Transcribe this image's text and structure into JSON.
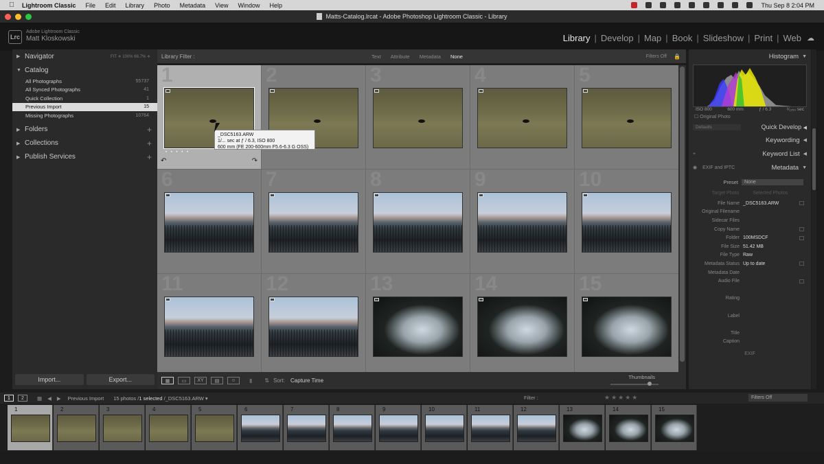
{
  "menubar": {
    "app": "Lightroom Classic",
    "items": [
      "File",
      "Edit",
      "Library",
      "Photo",
      "Metadata",
      "View",
      "Window",
      "Help"
    ],
    "clock": "Thu Sep 8  2:04 PM"
  },
  "window": {
    "title": "Matts-Catalog.lrcat - Adobe Photoshop Lightroom Classic - Library"
  },
  "identity": {
    "product": "Adobe Lightroom Classic",
    "user": "Matt Kloskowski",
    "logo": "Lrc"
  },
  "modules": [
    "Library",
    "Develop",
    "Map",
    "Book",
    "Slideshow",
    "Print",
    "Web"
  ],
  "left": {
    "navigator": {
      "label": "Navigator",
      "zoom": "FIT ≑  100%  66.7% ≑"
    },
    "catalog": {
      "label": "Catalog",
      "items": [
        {
          "name": "All Photographs",
          "count": "55737"
        },
        {
          "name": "All Synced Photographs",
          "count": "41"
        },
        {
          "name": "Quick Collection",
          "count": "1"
        },
        {
          "name": "Previous Import",
          "count": "15"
        },
        {
          "name": "Missing Photographs",
          "count": "10764"
        }
      ]
    },
    "folders": "Folders",
    "collections": "Collections",
    "publish": "Publish Services",
    "import_label": "Import...",
    "export_label": "Export..."
  },
  "filter": {
    "label": "Library Filter :",
    "options": [
      "Text",
      "Attribute",
      "Metadata",
      "None"
    ],
    "filters_off": "Filters Off"
  },
  "grid": {
    "cells": [
      {
        "num": "1",
        "photo": "gold"
      },
      {
        "num": "2",
        "photo": "gold"
      },
      {
        "num": "3",
        "photo": "gold"
      },
      {
        "num": "4",
        "photo": "gold"
      },
      {
        "num": "5",
        "photo": "gold"
      },
      {
        "num": "6",
        "photo": "blue"
      },
      {
        "num": "7",
        "photo": "blue"
      },
      {
        "num": "8",
        "photo": "blue"
      },
      {
        "num": "9",
        "photo": "blue"
      },
      {
        "num": "10",
        "photo": "blue"
      },
      {
        "num": "11",
        "photo": "blue"
      },
      {
        "num": "12",
        "photo": "blue"
      },
      {
        "num": "13",
        "photo": "forest"
      },
      {
        "num": "14",
        "photo": "forest"
      },
      {
        "num": "15",
        "photo": "forest"
      }
    ],
    "selected_index": 0
  },
  "tooltip": {
    "line1": "_DSC5163.ARW",
    "line2": "1/... sec at ƒ / 6.3, ISO 800",
    "line3": "600 mm (FE 200-600mm F5.6-6.3 G OSS)"
  },
  "toolbar": {
    "sort_label": "Sort:",
    "sort_value": "Capture Time",
    "thumbnails_label": "Thumbnails"
  },
  "right": {
    "histogram": {
      "label": "Histogram",
      "iso": "ISO 800",
      "focal": "600 mm",
      "aperture": "ƒ / 6.3",
      "shutter": "¹⁄₁₂₅₀ sec",
      "original": "Original Photo"
    },
    "quick_develop": {
      "label": "Quick Develop",
      "preset": "Defaults"
    },
    "keywording": "Keywording",
    "keyword_list": "Keyword List",
    "metadata": {
      "label": "Metadata",
      "set": "EXIF and IPTC",
      "preset_label": "Preset",
      "preset_value": "None",
      "target_photo": "Target Photo",
      "selected_photos": "Selected Photos",
      "rows": [
        {
          "label": "File Name",
          "value": "_DSC5163.ARW"
        },
        {
          "label": "Original Filename",
          "value": ""
        },
        {
          "label": "Sidecar Files",
          "value": ""
        },
        {
          "label": "Copy Name",
          "value": ""
        },
        {
          "label": "Folder",
          "value": "100MSDCF"
        },
        {
          "label": "File Size",
          "value": "51.42 MB"
        },
        {
          "label": "File Type",
          "value": "Raw"
        },
        {
          "label": "Metadata Status",
          "value": "Up to date"
        },
        {
          "label": "Metadata Date",
          "value": ""
        },
        {
          "label": "Audio File",
          "value": ""
        },
        {
          "label": "",
          "value": ""
        },
        {
          "label": "Rating",
          "value": ""
        },
        {
          "label": "",
          "value": ""
        },
        {
          "label": "Label",
          "value": ""
        },
        {
          "label": "",
          "value": ""
        },
        {
          "label": "Title",
          "value": ""
        },
        {
          "label": "Caption",
          "value": ""
        }
      ],
      "exif": "EXIF"
    }
  },
  "filmbar": {
    "view1": "1",
    "view2": "2",
    "source": "Previous Import",
    "count": "15 photos /",
    "selected": "1 selected",
    "file": "/_DSC5163.ARW ▾",
    "filter": "Filter :",
    "filters_off": "Filters Off"
  },
  "filmstrip": [
    "1",
    "2",
    "3",
    "4",
    "5",
    "6",
    "7",
    "8",
    "9",
    "10",
    "11",
    "12",
    "13",
    "14",
    "15"
  ]
}
